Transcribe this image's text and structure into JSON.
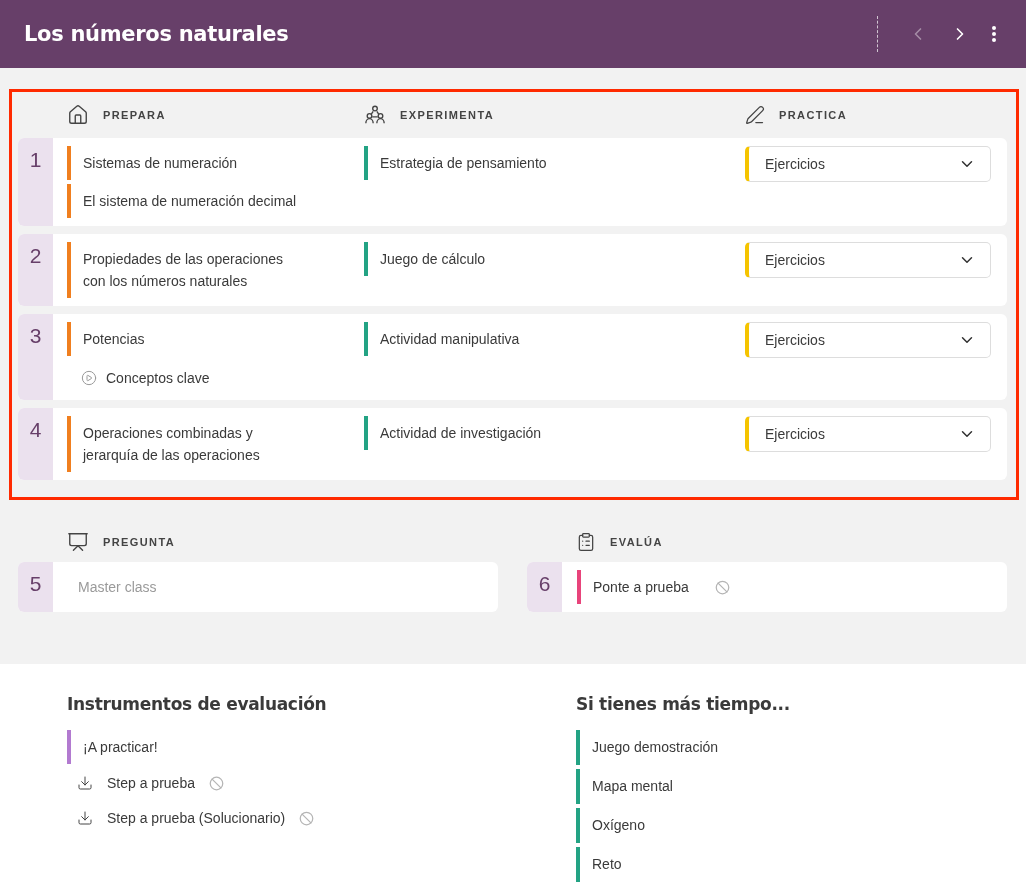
{
  "header": {
    "title": "Los números naturales",
    "prev_disabled": true
  },
  "highlighted": true,
  "columns": [
    {
      "label": "PREPARA",
      "kind": "home"
    },
    {
      "label": "EXPERIMENTA",
      "kind": "people"
    },
    {
      "label": "PRACTICA",
      "kind": "pencil"
    }
  ],
  "rows": [
    {
      "number": "1",
      "prepara": [
        {
          "text": "Sistemas de numeración",
          "kind": "bar"
        },
        {
          "text": "El sistema de numeración decimal",
          "kind": "bar"
        }
      ],
      "experimenta": [
        {
          "text": "Estrategia de pensamiento",
          "kind": "bar"
        }
      ],
      "practica": {
        "value": "Ejercicios"
      }
    },
    {
      "number": "2",
      "prepara": [
        {
          "text": "Propiedades de las operaciones con los números naturales",
          "kind": "bar"
        }
      ],
      "experimenta": [
        {
          "text": "Juego de cálculo",
          "kind": "bar"
        }
      ],
      "practica": {
        "value": "Ejercicios"
      }
    },
    {
      "number": "3",
      "prepara": [
        {
          "text": "Potencias",
          "kind": "bar"
        },
        {
          "text": "Conceptos clave",
          "kind": "video"
        }
      ],
      "experimenta": [
        {
          "text": "Actividad manipulativa",
          "kind": "bar"
        }
      ],
      "practica": {
        "value": "Ejercicios"
      }
    },
    {
      "number": "4",
      "prepara": [
        {
          "text": "Operaciones combinadas y jerarquía de las operaciones",
          "kind": "bar"
        }
      ],
      "experimenta": [
        {
          "text": "Actividad de investigación",
          "kind": "bar"
        }
      ],
      "practica": {
        "value": "Ejercicios"
      }
    }
  ],
  "sections": [
    {
      "label": "PREGUNTA",
      "number": "5",
      "item": {
        "text": "Master class",
        "kind": "placeholder",
        "blocked": false
      }
    },
    {
      "label": "EVALÚA",
      "number": "6",
      "item": {
        "text": "Ponte a prueba",
        "kind": "bar",
        "blocked": true
      }
    }
  ],
  "instruments": {
    "title": "Instrumentos de evaluación",
    "items": [
      {
        "text": "¡A practicar!",
        "kind": "bar",
        "blocked": false
      },
      {
        "text": "Step a prueba",
        "kind": "download",
        "blocked": true
      },
      {
        "text": "Step a prueba (Solucionario)",
        "kind": "download",
        "blocked": true
      }
    ]
  },
  "more_time": {
    "title": "Si tienes más tiempo...",
    "items": [
      {
        "text": "Juego demostración"
      },
      {
        "text": "Mapa mental"
      },
      {
        "text": "Oxígeno"
      },
      {
        "text": "Reto"
      }
    ]
  }
}
